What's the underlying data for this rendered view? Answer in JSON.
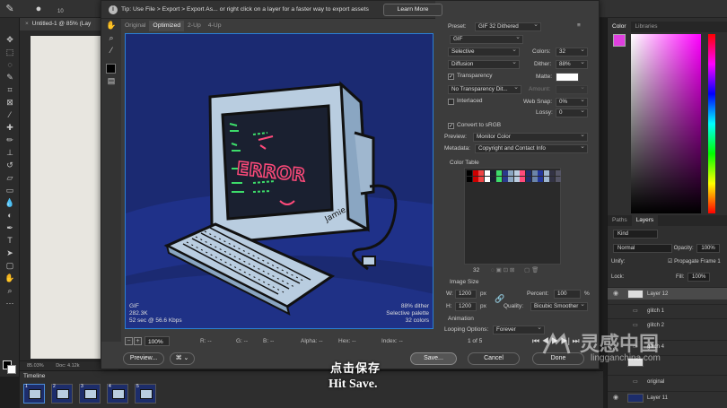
{
  "ps": {
    "doc_tab": "Untitled-1 @ 85% (Lay",
    "option_num": "10",
    "status_zoom": "85.03%",
    "status_doc": "Doc: 4.12k",
    "timeline_label": "Timeline",
    "frames": [
      "1",
      "2",
      "3",
      "4",
      "5"
    ]
  },
  "dialog": {
    "tip": "Tip: Use File > Export > Export As... or right click on a layer for a faster way to export assets",
    "learn_more": "Learn More",
    "view_tabs": [
      "Original",
      "Optimized",
      "2-Up",
      "4-Up"
    ],
    "preview": {
      "error_text": "ERROR",
      "signature": "Jamie",
      "info_left": [
        "GIF",
        "282.3K",
        "52 sec @ 56.6 Kbps"
      ],
      "info_right": [
        "88% dither",
        "Selective palette",
        "32 colors"
      ]
    },
    "zoom": "100%",
    "readouts": {
      "r": "R: --",
      "g": "G: --",
      "b": "B: --",
      "alpha": "Alpha: --",
      "hex": "Hex: --",
      "index": "Index: --"
    },
    "buttons": {
      "preview": "Preview...",
      "save": "Save...",
      "cancel": "Cancel",
      "done": "Done"
    },
    "settings": {
      "preset_label": "Preset:",
      "preset": "GIF 32 Dithered",
      "format": "GIF",
      "reduction": "Selective",
      "colors_label": "Colors:",
      "colors": "32",
      "dither_algo": "Diffusion",
      "dither_label": "Dither:",
      "dither": "88%",
      "transparency": "Transparency",
      "matte_label": "Matte:",
      "transparency_dither": "No Transparency Dit...",
      "amount_label": "Amount:",
      "interlaced": "Interlaced",
      "websnap_label": "Web Snap:",
      "websnap": "0%",
      "lossy_label": "Lossy:",
      "lossy": "0",
      "convert_srgb": "Convert to sRGB",
      "preview_label": "Preview:",
      "preview_val": "Monitor Color",
      "metadata_label": "Metadata:",
      "metadata_val": "Copyright and Contact Info",
      "color_table": "Color Table",
      "color_count": "32",
      "image_size": "Image Size",
      "w_label": "W:",
      "w": "1200",
      "h_label": "H:",
      "h": "1200",
      "px": "px",
      "percent_label": "Percent:",
      "percent": "100",
      "pct": "%",
      "quality_label": "Quality:",
      "quality": "Bicubic Smoother",
      "animation": "Animation",
      "looping_label": "Looping Options:",
      "looping": "Forever",
      "frame_counter": "1 of 5"
    }
  },
  "panels": {
    "color_tabs": [
      "Color",
      "Libraries"
    ],
    "layer_tabs": [
      "Paths",
      "Layers"
    ],
    "kind": "Kind",
    "blend": "Normal",
    "opacity_label": "Opacity:",
    "opacity": "100%",
    "unify_label": "Unify:",
    "propagate": "Propagate Frame 1",
    "lock_label": "Lock:",
    "fill_label": "Fill:",
    "fill": "100%",
    "layers": [
      "Layer 12",
      "glitch 1",
      "glitch 2",
      "glitch 4",
      "",
      "original",
      "Layer 11"
    ]
  },
  "subtitle": {
    "cn": "点击保存",
    "en": "Hit Save."
  },
  "watermark": {
    "cn": "灵感中国",
    "en": "lingganchina.com"
  }
}
